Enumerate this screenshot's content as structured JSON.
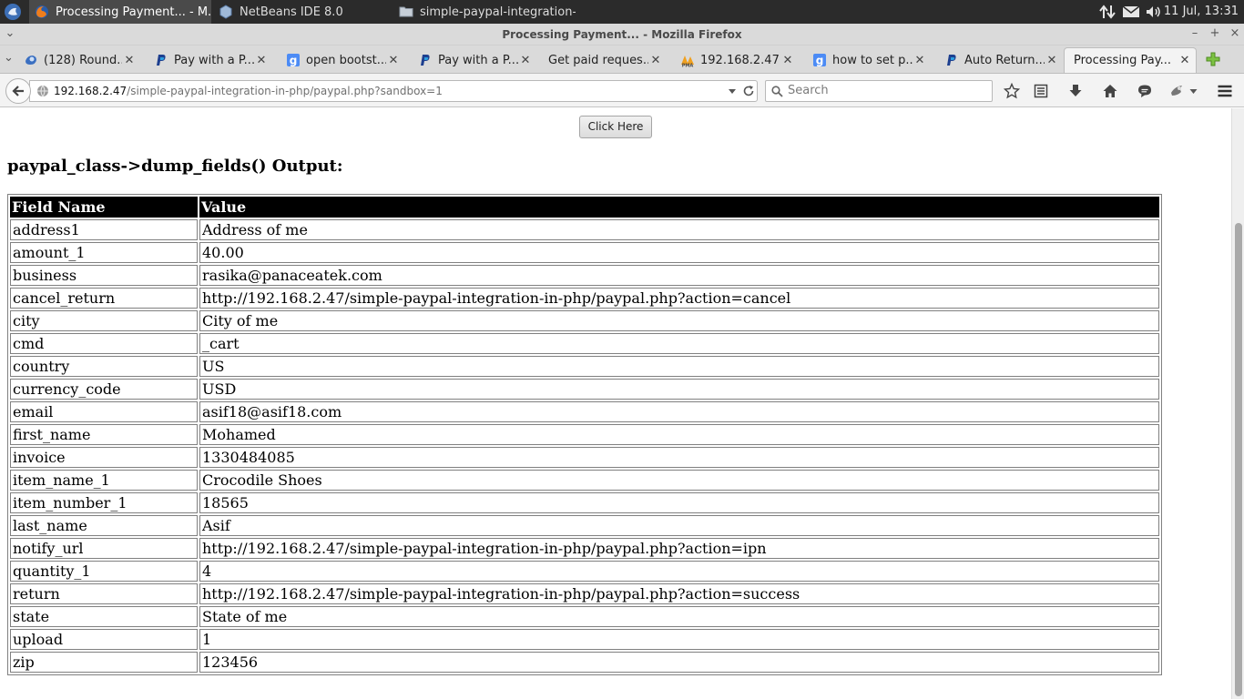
{
  "taskbar": {
    "tasks": [
      {
        "label": "Processing Payment... - M..."
      },
      {
        "label": "NetBeans IDE 8.0"
      },
      {
        "label": "simple-paypal-integration-..."
      }
    ],
    "clock": "11 Jul, 13:31"
  },
  "window": {
    "title": "Processing Payment... - Mozilla Firefox"
  },
  "tabs": [
    {
      "label": "(128) Round...",
      "icon": "round-favicon-icon"
    },
    {
      "label": "Pay with a P...",
      "icon": "paypal-favicon-icon"
    },
    {
      "label": "open bootst...",
      "icon": "google-favicon-icon"
    },
    {
      "label": "Pay with a P...",
      "icon": "paypal-favicon-icon"
    },
    {
      "label": "Get paid reques...",
      "icon": "none"
    },
    {
      "label": "192.168.2.47...",
      "icon": "phpmyadmin-favicon-icon"
    },
    {
      "label": "how to set p...",
      "icon": "google-favicon-icon"
    },
    {
      "label": "Auto Return...",
      "icon": "paypal-favicon-icon"
    },
    {
      "label": "Processing Pay...",
      "icon": "none",
      "active": true
    }
  ],
  "nav": {
    "url_host": "192.168.2.47",
    "url_path": "/simple-paypal-integration-in-php/paypal.php?sandbox=1",
    "search_placeholder": "Search"
  },
  "page": {
    "button_label": "Click Here",
    "heading": "paypal_class->dump_fields() Output:",
    "table": {
      "headers": [
        "Field Name",
        "Value"
      ],
      "rows": [
        [
          "address1",
          "Address of me"
        ],
        [
          "amount_1",
          "40.00"
        ],
        [
          "business",
          "rasika@panaceatek.com"
        ],
        [
          "cancel_return",
          "http://192.168.2.47/simple-paypal-integration-in-php/paypal.php?action=cancel"
        ],
        [
          "city",
          "City of me"
        ],
        [
          "cmd",
          "_cart"
        ],
        [
          "country",
          "US"
        ],
        [
          "currency_code",
          "USD"
        ],
        [
          "email",
          "asif18@asif18.com"
        ],
        [
          "first_name",
          "Mohamed"
        ],
        [
          "invoice",
          "1330484085"
        ],
        [
          "item_name_1",
          "Crocodile Shoes"
        ],
        [
          "item_number_1",
          "18565"
        ],
        [
          "last_name",
          "Asif"
        ],
        [
          "notify_url",
          "http://192.168.2.47/simple-paypal-integration-in-php/paypal.php?action=ipn"
        ],
        [
          "quantity_1",
          "4"
        ],
        [
          "return",
          "http://192.168.2.47/simple-paypal-integration-in-php/paypal.php?action=success"
        ],
        [
          "state",
          "State of me"
        ],
        [
          "upload",
          "1"
        ],
        [
          "zip",
          "123456"
        ]
      ]
    }
  }
}
